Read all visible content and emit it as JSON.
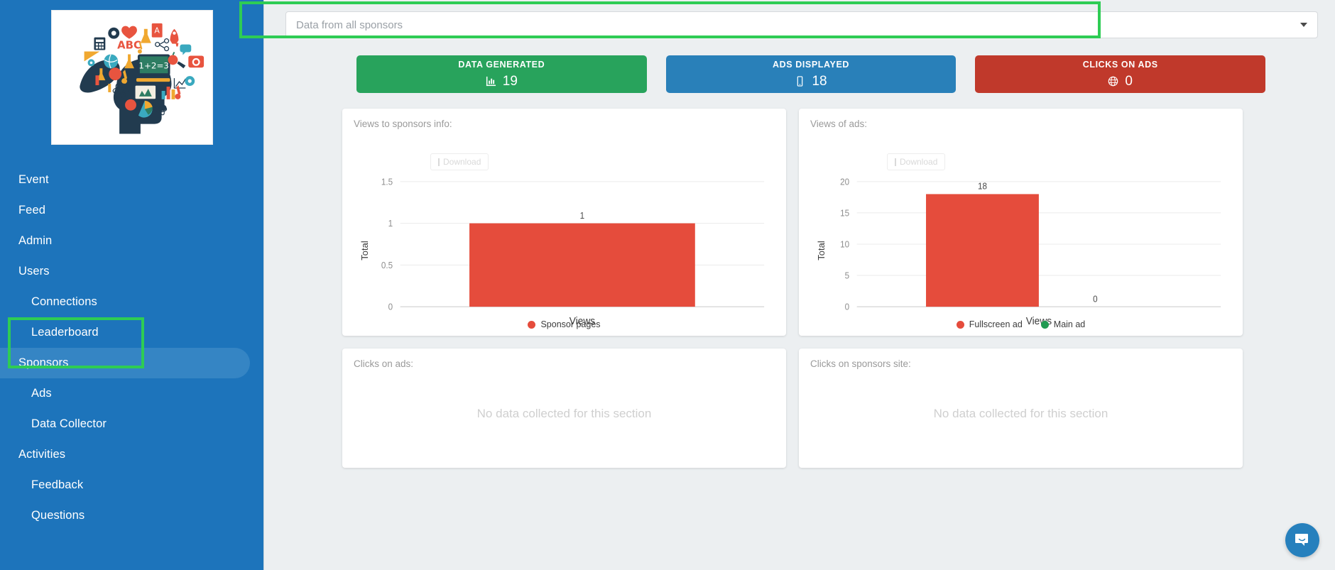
{
  "sidebar": {
    "logo_alt": "brain-education-logo",
    "items": [
      {
        "label": "Event",
        "level": 0,
        "active": false
      },
      {
        "label": "Feed",
        "level": 0,
        "active": false
      },
      {
        "label": "Admin",
        "level": 0,
        "active": false
      },
      {
        "label": "Users",
        "level": 0,
        "active": false
      },
      {
        "label": "Connections",
        "level": 1,
        "active": false
      },
      {
        "label": "Leaderboard",
        "level": 1,
        "active": false
      },
      {
        "label": "Sponsors",
        "level": 0,
        "active": true
      },
      {
        "label": "Ads",
        "level": 1,
        "active": false
      },
      {
        "label": "Data Collector",
        "level": 1,
        "active": false
      },
      {
        "label": "Activities",
        "level": 0,
        "active": false
      },
      {
        "label": "Feedback",
        "level": 1,
        "active": false
      },
      {
        "label": "Questions",
        "level": 1,
        "active": false
      }
    ]
  },
  "filter": {
    "selected": "Data from all sponsors",
    "caret_icon": "chevron-down-icon"
  },
  "stats": [
    {
      "title": "DATA GENERATED",
      "value": "19",
      "color": "#28a35c",
      "icon": "bar-chart-icon"
    },
    {
      "title": "ADS DISPLAYED",
      "value": "18",
      "color": "#2980b9",
      "icon": "mobile-phone-icon"
    },
    {
      "title": "CLICKS ON ADS",
      "value": "0",
      "color": "#c0392b",
      "icon": "globe-icon"
    }
  ],
  "panels": {
    "views_sponsors": {
      "title": "Views to sponsors info:",
      "download_label": "Download"
    },
    "views_ads": {
      "title": "Views of ads:",
      "download_label": "Download"
    },
    "clicks_ads": {
      "title": "Clicks on ads:",
      "empty_message": "No data collected for this section"
    },
    "clicks_sponsors_site": {
      "title": "Clicks on sponsors site:",
      "empty_message": "No data collected for this section"
    }
  },
  "chart_data": [
    {
      "id": "views_to_sponsors_info",
      "type": "bar",
      "title": "Views to sponsors info:",
      "categories": [
        "Views"
      ],
      "series": [
        {
          "name": "Sponsor pages",
          "color": "#e54c3c",
          "values": [
            1
          ]
        }
      ],
      "data_labels": [
        "1"
      ],
      "xlabel": "Views",
      "ylabel": "Total",
      "ylim": [
        0,
        1.5
      ],
      "yticks": [
        "0",
        "0.5",
        "1",
        "1.5"
      ],
      "ytick_values": [
        0,
        0.5,
        1,
        1.5
      ],
      "grid": true,
      "legend_position": "bottom"
    },
    {
      "id": "views_of_ads",
      "type": "bar",
      "title": "Views of ads:",
      "categories": [
        "Views"
      ],
      "series": [
        {
          "name": "Fullscreen ad",
          "color": "#e54c3c",
          "values": [
            18
          ]
        },
        {
          "name": "Main ad",
          "color": "#219a52",
          "values": [
            0
          ]
        }
      ],
      "data_labels": [
        "18",
        "0"
      ],
      "xlabel": "Views",
      "ylabel": "Total",
      "ylim": [
        0,
        20
      ],
      "yticks": [
        "0",
        "5",
        "10",
        "15",
        "20"
      ],
      "ytick_values": [
        0,
        5,
        10,
        15,
        20
      ],
      "grid": true,
      "legend_position": "bottom"
    }
  ],
  "chat": {
    "icon": "chat-bubble-smile-icon"
  },
  "annotations": {
    "highlight_color": "#2ecc54",
    "boxes": [
      "filter-dropdown",
      "sidebar-sponsors-ads"
    ]
  }
}
